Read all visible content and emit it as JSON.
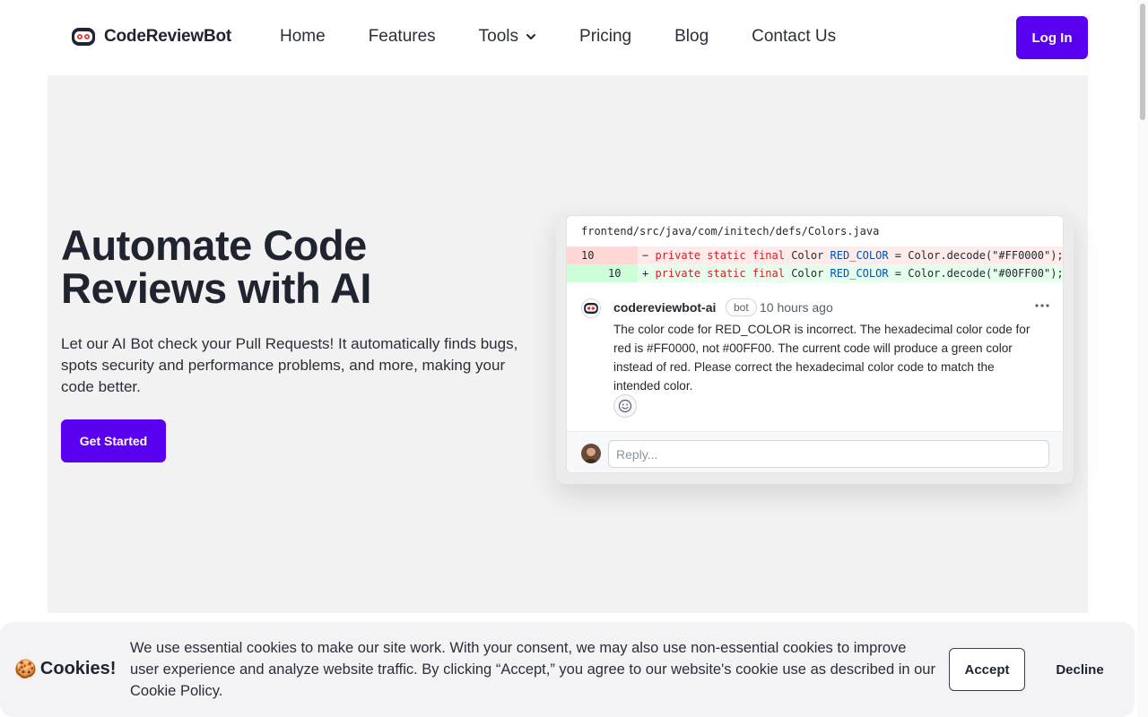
{
  "header": {
    "brand_name": "CodeReviewBot",
    "nav": [
      {
        "label": "Home"
      },
      {
        "label": "Features"
      },
      {
        "label": "Tools"
      },
      {
        "label": "Pricing"
      },
      {
        "label": "Blog"
      },
      {
        "label": "Contact Us"
      }
    ],
    "login_label": "Log In"
  },
  "hero": {
    "title": "Automate Code Reviews with AI",
    "subtitle": "Let our AI Bot check your Pull Requests! It automatically finds bugs, spots security and performance problems, and more, making your code better.",
    "cta_label": "Get Started"
  },
  "review": {
    "file_path": "frontend/src/java/com/initech/defs/Colors.java",
    "deleted": {
      "line": "10",
      "marker": "−",
      "keyword": "private static final",
      "type": " Color ",
      "name": "RED_COLOR",
      "rest": " = Color.decode(\"#FF0000\");"
    },
    "added": {
      "line": "10",
      "marker": "+",
      "keyword": "private static final",
      "type": " Color ",
      "name": "RED_COLOR",
      "rest": " = Color.decode(\"#00FF00\");"
    },
    "comment": {
      "author": "codereviewbot-ai",
      "badge": "bot",
      "time": "10 hours ago",
      "body": "The color code for RED_COLOR is incorrect. The hexadecimal color code for red is #FF0000, not #00FF00. The current code will produce a green color instead of red. Please correct the hexadecimal color code to match the intended color."
    },
    "reply_placeholder": "Reply..."
  },
  "cookie": {
    "emoji": "🍪",
    "title": "Cookies!",
    "text": "We use essential cookies to make our site work. With your consent, we may also use non-essential cookies to improve user experience and analyze website traffic. By clicking “Accept,” you agree to our website's cookie use as described in our Cookie Policy.",
    "accept_label": "Accept",
    "decline_label": "Decline"
  },
  "colors": {
    "accent": "#5a00f0",
    "hero_bg": "#f2f2f2",
    "diff_del_bg": "#ffebe9",
    "diff_add_bg": "#e6ffec"
  }
}
